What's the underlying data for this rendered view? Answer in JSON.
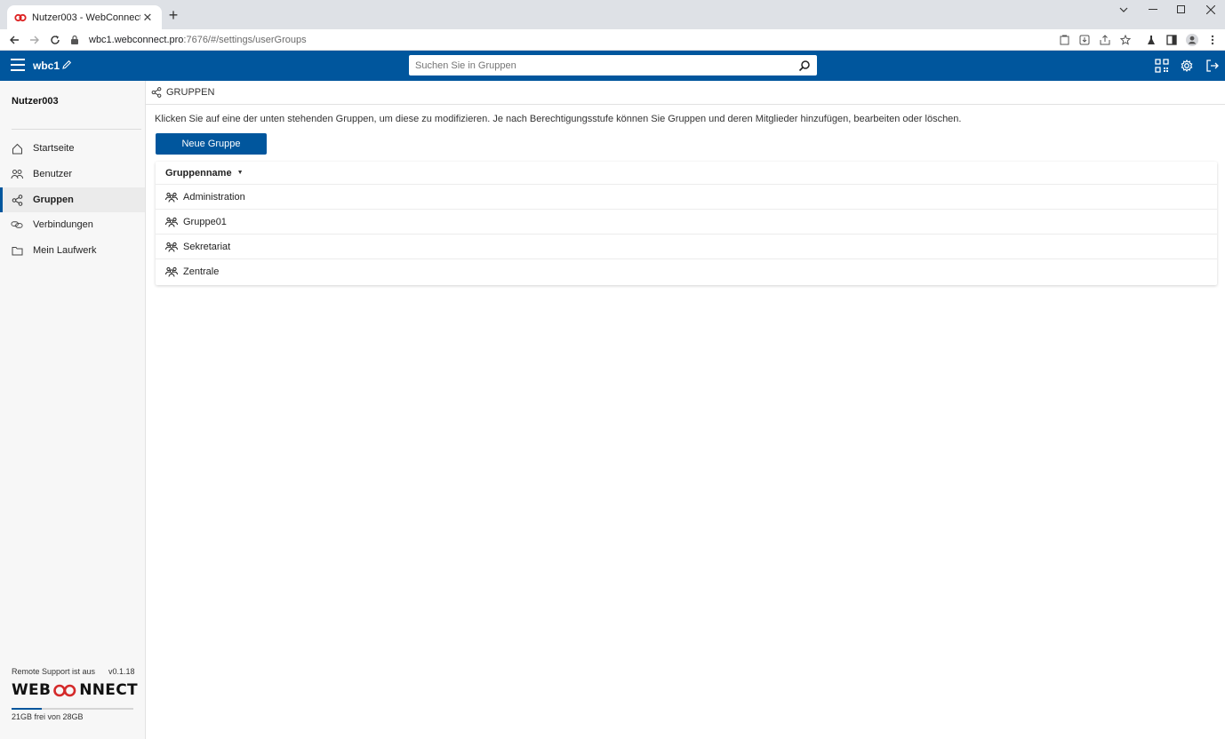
{
  "browser": {
    "tab_title": "Nutzer003 - WebConnect",
    "new_tab": "+",
    "close_tab": "✕",
    "url_host": "wbc1.webconnect.pro",
    "url_path": ":7676/#/settings/userGroups"
  },
  "header": {
    "app_name": "wbc1",
    "search_placeholder": "Suchen Sie in Gruppen",
    "accent_color": "#00569d"
  },
  "sidebar": {
    "user": "Nutzer003",
    "items": [
      {
        "label": "Startseite",
        "icon": "home-icon"
      },
      {
        "label": "Benutzer",
        "icon": "users-icon"
      },
      {
        "label": "Gruppen",
        "icon": "share-nodes-icon",
        "active": true
      },
      {
        "label": "Verbindungen",
        "icon": "link-icon"
      },
      {
        "label": "Mein Laufwerk",
        "icon": "folder-icon"
      }
    ],
    "remote_support": "Remote Support ist aus",
    "version": "v0.1.18",
    "logo_left": "WEB",
    "logo_right": "NNECT",
    "storage_text": "21GB frei von 28GB",
    "storage_used_fraction": 0.25
  },
  "main": {
    "breadcrumb": "GRUPPEN",
    "intro": "Klicken Sie auf eine der unten stehenden Gruppen, um diese zu modifizieren. Je nach Berechtigungsstufe können Sie Gruppen und deren Mitglieder hinzufügen, bearbeiten oder löschen.",
    "new_group_button": "Neue Gruppe",
    "table": {
      "column": "Gruppenname",
      "rows": [
        "Administration",
        "Gruppe01",
        "Sekretariat",
        "Zentrale"
      ]
    }
  }
}
